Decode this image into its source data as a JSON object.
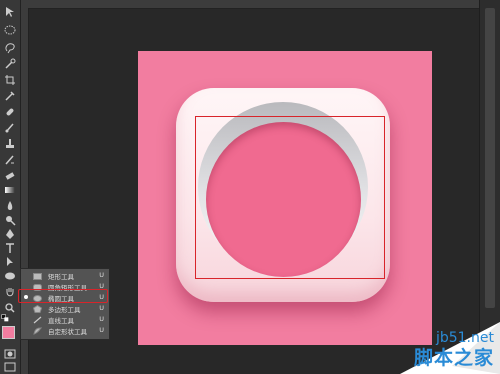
{
  "tools_flyout": {
    "items": [
      {
        "label": "矩形工具",
        "key": "U",
        "icon": "rectangle-icon"
      },
      {
        "label": "圆角矩形工具",
        "key": "U",
        "icon": "rounded-rectangle-icon"
      },
      {
        "label": "椭圆工具",
        "key": "U",
        "icon": "ellipse-icon",
        "active": true
      },
      {
        "label": "多边形工具",
        "key": "U",
        "icon": "polygon-icon"
      },
      {
        "label": "直线工具",
        "key": "U",
        "icon": "line-icon"
      },
      {
        "label": "自定形状工具",
        "key": "U",
        "icon": "custom-shape-icon"
      }
    ]
  },
  "colors": {
    "foreground": "#f27da0",
    "background": "#ffffff",
    "highlight": "#d8242a"
  },
  "watermark": {
    "line1": "jb51.net",
    "line2": "脚本之家"
  }
}
